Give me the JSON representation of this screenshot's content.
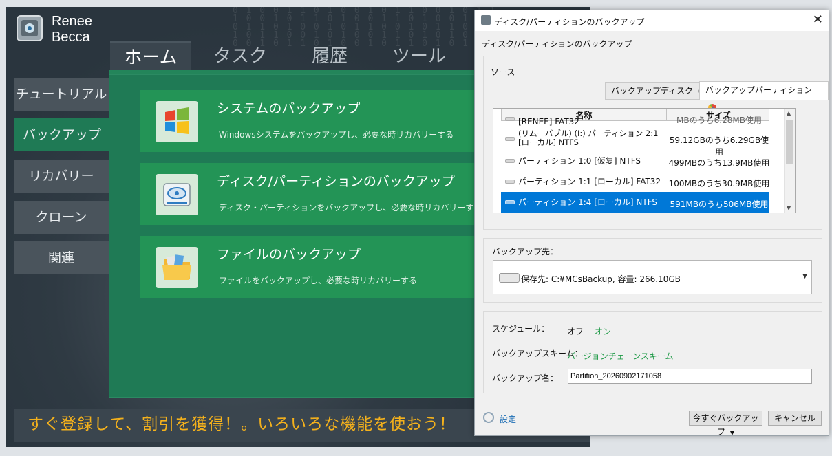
{
  "app": {
    "logo_text_1": "Renee",
    "logo_text_2": "Becca",
    "nav_tabs": [
      "ホーム",
      "タスク",
      "履歴",
      "ツール"
    ],
    "sidebar": [
      "チュートリアル",
      "バックアップ",
      "リカバリー",
      "クローン",
      "関連"
    ],
    "cards": [
      {
        "title": "システムのバックアップ",
        "desc": "Windowsシステムをバックアップし、必要な時リカバリーする",
        "icon": "windows-logo-icon"
      },
      {
        "title": "ディスク/パーティションのバックアップ",
        "desc": "ディスク・パーティションをバックアップし、必要な時リカバリーする",
        "icon": "hard-disk-icon"
      },
      {
        "title": "ファイルのバックアップ",
        "desc": "ファイルをバックアップし、必要な時リカバリーする",
        "icon": "folder-icon"
      }
    ],
    "promo": "すぐ登録して、割引を獲得！。いろいろな機能を使おう！"
  },
  "dialog": {
    "title": "ディスク/パーティションのバックアップ",
    "subtitle": "ディスク/パーティションのバックアップ",
    "source_label": "ソース",
    "tabs": [
      "バックアップディスク",
      "バックアップパーティション"
    ],
    "columns": [
      "名称",
      "サイズ"
    ],
    "rows": [
      {
        "name": "[RENEE] FAT32",
        "size": "MBのうち6.28MB使用"
      },
      {
        "name": "(リムーバブル) (I:) パーティション 2:1 [ローカル] NTFS",
        "size": "59.12GBのうち6.29GB使用"
      },
      {
        "name": "パーティション 1:0 [仮复] NTFS",
        "size": "499MBのうち13.9MB使用"
      },
      {
        "name": "パーティション 1:1 [ローカル] FAT32",
        "size": "100MBのうち30.9MB使用"
      },
      {
        "name": "パーティション 1:4 [ローカル] NTFS",
        "size": "591MBのうち506MB使用",
        "selected": true
      }
    ],
    "dest_label": "バックアップ先：",
    "dest_value": "保存先: C:¥MCsBackup, 容量: 266.10GB",
    "schedule_label": "スケジュール：",
    "schedule_off": "オフ",
    "schedule_on": "オン",
    "scheme_label": "バックアップスキーム：",
    "scheme_value": "バージョンチェーンスキーム",
    "name_label": "バックアップ名：",
    "name_value": "Partition_20260902171058",
    "settings": "設定",
    "backup_now": "今すぐバックアップ",
    "cancel": "キャンセル"
  },
  "colors": {
    "accent_green": "#239456",
    "selection_blue": "#0078d7",
    "promo_orange": "#f4b11c"
  }
}
